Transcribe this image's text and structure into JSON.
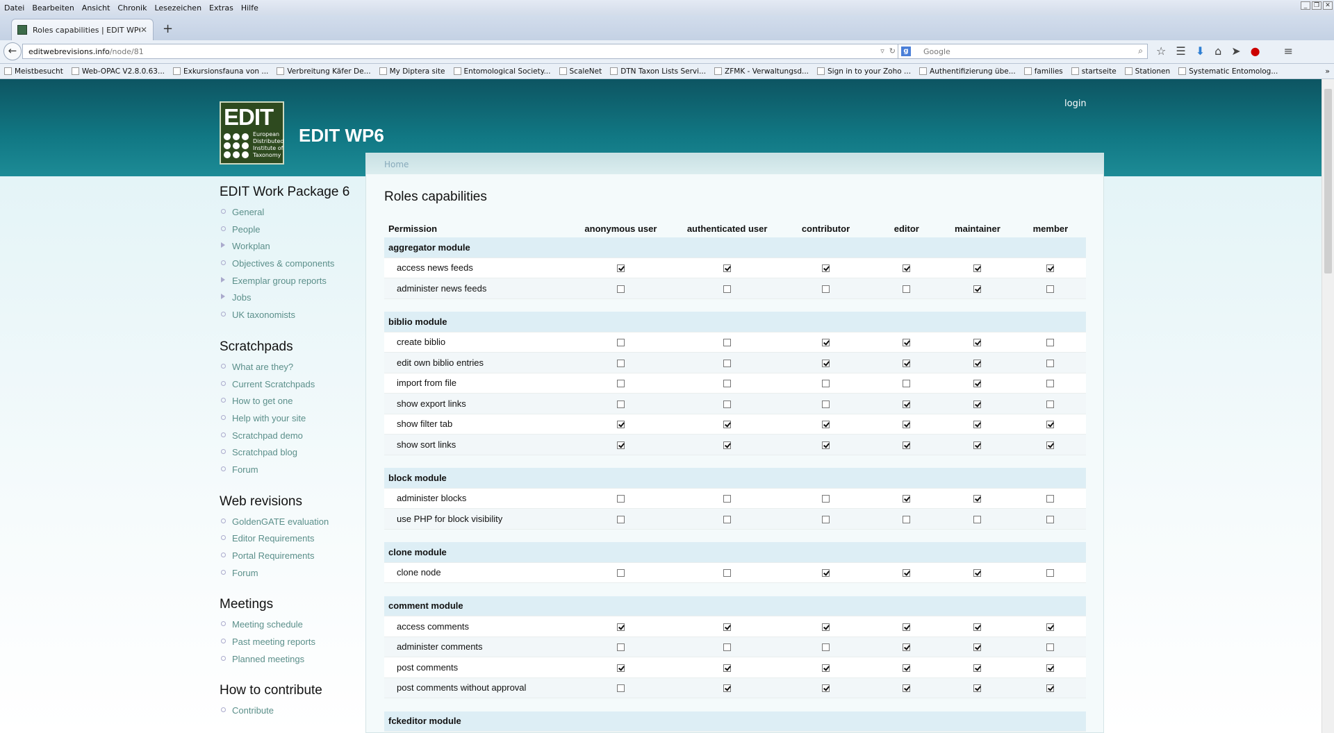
{
  "menubar": [
    "Datei",
    "Bearbeiten",
    "Ansicht",
    "Chronik",
    "Lesezeichen",
    "Extras",
    "Hilfe"
  ],
  "tab": {
    "title": "Roles capabilities | EDIT WP6"
  },
  "address": {
    "host": "editwebrevisions.info",
    "path": "/node/81"
  },
  "search": {
    "placeholder": "Google"
  },
  "bookmarks": [
    "Meistbesucht",
    "Web-OPAC V2.8.0.63...",
    "Exkursionsfauna von ...",
    "Verbreitung Käfer De...",
    "My Diptera site",
    "Entomological Society...",
    "ScaleNet",
    "DTN Taxon Lists Servi...",
    "ZFMK - Verwaltungsd...",
    "Sign in to your Zoho ...",
    "Authentifizierung übe...",
    "families",
    "startseite",
    "Stationen",
    "Systematic Entomolog..."
  ],
  "site": {
    "logo_word": "EDIT",
    "logo_sub": "European Distributed Institute of Taxonomy",
    "name": "EDIT WP6",
    "login": "login",
    "breadcrumb": "Home"
  },
  "sidebar": [
    {
      "heading": "EDIT Work Package 6",
      "items": [
        "General",
        "People",
        "Workplan",
        "Objectives & components",
        "Exemplar group reports",
        "Jobs",
        "UK taxonomists"
      ]
    },
    {
      "heading": "Scratchpads",
      "items": [
        "What are they?",
        "Current Scratchpads",
        "How to get one",
        "Help with your site",
        "Scratchpad demo",
        "Scratchpad blog",
        "Forum"
      ]
    },
    {
      "heading": "Web revisions",
      "items": [
        "GoldenGATE evaluation",
        "Editor Requirements",
        "Portal Requirements",
        "Forum"
      ]
    },
    {
      "heading": "Meetings",
      "items": [
        "Meeting schedule",
        "Past meeting reports",
        "Planned meetings"
      ]
    },
    {
      "heading": "How to contribute",
      "items": [
        "Contribute"
      ]
    }
  ],
  "page": {
    "title": "Roles capabilities"
  },
  "table": {
    "columns": [
      "Permission",
      "anonymous user",
      "authenticated user",
      "contributor",
      "editor",
      "maintainer",
      "member"
    ],
    "modules": [
      {
        "name": "aggregator module",
        "perms": [
          {
            "name": "access news feeds",
            "v": [
              1,
              1,
              1,
              1,
              1,
              1
            ]
          },
          {
            "name": "administer news feeds",
            "v": [
              0,
              0,
              0,
              0,
              1,
              0
            ]
          }
        ]
      },
      {
        "name": "biblio module",
        "perms": [
          {
            "name": "create biblio",
            "v": [
              0,
              0,
              1,
              1,
              1,
              0
            ]
          },
          {
            "name": "edit own biblio entries",
            "v": [
              0,
              0,
              1,
              1,
              1,
              0
            ]
          },
          {
            "name": "import from file",
            "v": [
              0,
              0,
              0,
              0,
              1,
              0
            ]
          },
          {
            "name": "show export links",
            "v": [
              0,
              0,
              0,
              1,
              1,
              0
            ]
          },
          {
            "name": "show filter tab",
            "v": [
              1,
              1,
              1,
              1,
              1,
              1
            ]
          },
          {
            "name": "show sort links",
            "v": [
              1,
              1,
              1,
              1,
              1,
              1
            ]
          }
        ]
      },
      {
        "name": "block module",
        "perms": [
          {
            "name": "administer blocks",
            "v": [
              0,
              0,
              0,
              1,
              1,
              0
            ]
          },
          {
            "name": "use PHP for block visibility",
            "v": [
              0,
              0,
              0,
              0,
              0,
              0
            ]
          }
        ]
      },
      {
        "name": "clone module",
        "perms": [
          {
            "name": "clone node",
            "v": [
              0,
              0,
              1,
              1,
              1,
              0
            ]
          }
        ]
      },
      {
        "name": "comment module",
        "perms": [
          {
            "name": "access comments",
            "v": [
              1,
              1,
              1,
              1,
              1,
              1
            ]
          },
          {
            "name": "administer comments",
            "v": [
              0,
              0,
              0,
              1,
              1,
              0
            ]
          },
          {
            "name": "post comments",
            "v": [
              1,
              1,
              1,
              1,
              1,
              1
            ]
          },
          {
            "name": "post comments without approval",
            "v": [
              0,
              1,
              1,
              1,
              1,
              1
            ]
          }
        ]
      },
      {
        "name": "fckeditor module",
        "perms": []
      }
    ]
  }
}
